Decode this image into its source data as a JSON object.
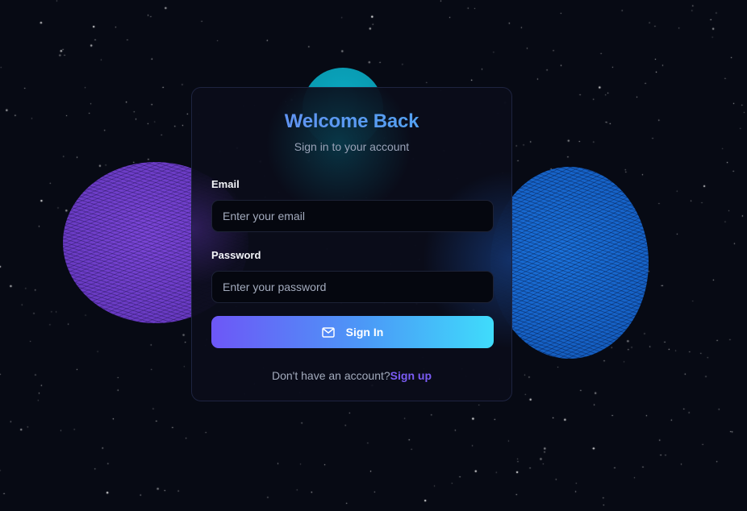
{
  "login": {
    "title": "Welcome Back",
    "subtitle": "Sign in to your account",
    "email_label": "Email",
    "email_placeholder": "Enter your email",
    "email_value": "",
    "password_label": "Password",
    "password_placeholder": "Enter your password",
    "password_value": "",
    "submit_label": "Sign In",
    "submit_icon": "mail-icon",
    "footer_text": "Don't have an account?",
    "signup_link": "Sign up"
  },
  "colors": {
    "background": "#070a14",
    "card": "#0a0d1a",
    "title_gradient_start": "#6a8cf5",
    "title_gradient_end": "#4aa8ee",
    "button_gradient_start": "#6d57f7",
    "button_gradient_end": "#3fdcfb",
    "link": "#7b5cf5",
    "orb_purple": "#6a3bc4",
    "orb_blue": "#1663c8",
    "orb_teal": "#0891a8"
  }
}
